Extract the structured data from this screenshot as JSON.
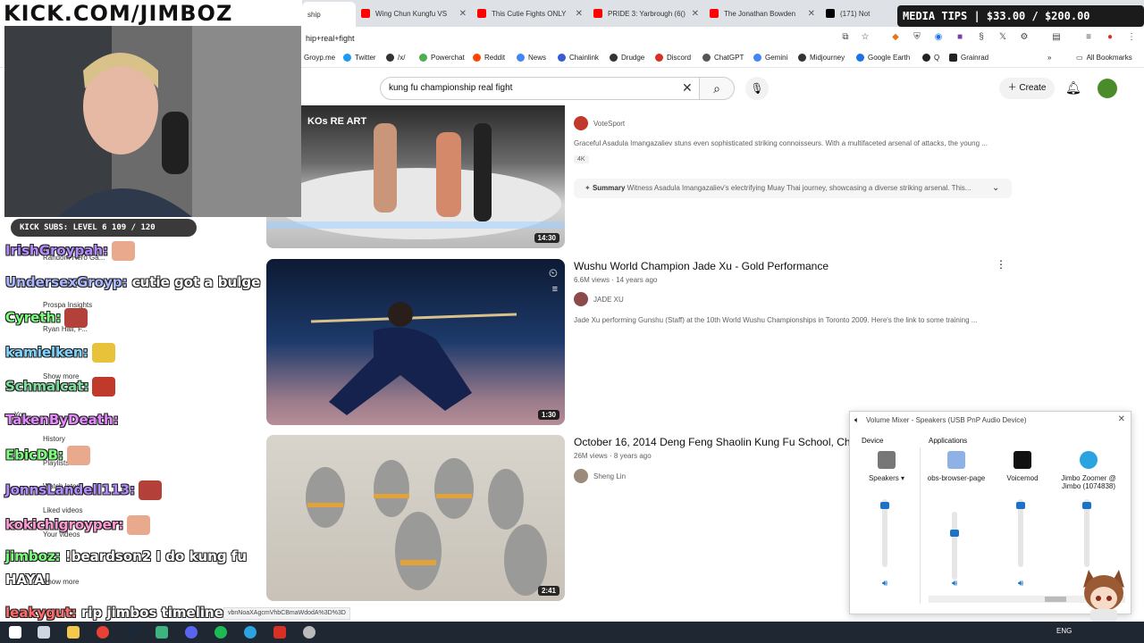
{
  "browser": {
    "tabs": [
      {
        "label": "ship",
        "active": true,
        "color": "#ff0000"
      },
      {
        "label": "Wing Chun Kungfu VS",
        "color": "#ff0000"
      },
      {
        "label": "This Cutie Fights ONLY",
        "color": "#ff0000"
      },
      {
        "label": "PRIDE 3: Yarbrough (6()",
        "color": "#ff0000"
      },
      {
        "label": "The Jonathan Bowden",
        "color": "#ff0000"
      },
      {
        "label": "(171) Not",
        "color": "#000000"
      }
    ],
    "url": "hip+real+fight",
    "bookmarks": [
      "Groyp.me",
      "Twitter",
      "/x/",
      "Powerchat",
      "Reddit",
      "News",
      "Chainlink",
      "Drudge",
      "Discord",
      "ChatGPT",
      "Gemini",
      "Midjourney",
      "Google Earth",
      "Q",
      "Grainrad"
    ],
    "all_bookmarks": "All Bookmarks",
    "status_url": "vbnNoaXAgcmVhbCBmaWdodA%3D%3D"
  },
  "youtube": {
    "search_query": "kung fu championship real fight",
    "create_label": "Create",
    "results": [
      {
        "channel": "VoteSport",
        "description": "Graceful Asadula Imangazaliev stuns even sophisticated striking connoisseurs. With a multifaceted arsenal of attacks, the young ...",
        "badge": "4K",
        "summary_label": "Summary",
        "summary_text": "Witness Asadula Imangazaliev's electrifying Muay Thai journey, showcasing a diverse striking arsenal. This...",
        "duration": "14:30",
        "thumb_text": "KOs RE ART"
      },
      {
        "title": "Wushu World Champion Jade Xu - Gold Performance",
        "meta": "6.6M views · 14 years ago",
        "channel": "JADE XU",
        "description": "Jade Xu performing Gunshu (Staff) at the 10th World Wushu Championships in Toronto 2009. Here's the link to some training ...",
        "duration": "1:30"
      },
      {
        "title": "October 16, 2014 Deng Feng Shaolin Kung Fu School, Chin",
        "meta": "26M views · 8 years ago",
        "channel": "Sheng Lin",
        "duration": "2:41"
      }
    ]
  },
  "overlay": {
    "kick_banner": "KICK.COM/JIMBOZ",
    "media_tips": "MEDIA TIPS | $33.00 / $200.00",
    "sub_bar": "KICK SUBS: LEVEL 6 109 / 120"
  },
  "sidebar": [
    "Random Hero Ga...",
    "Prospa Insights",
    "Ryan Hall, F...",
    "Show more",
    "You",
    "History",
    "Playlists",
    "Watch later",
    "Liked videos",
    "Your videos",
    "Show more"
  ],
  "chat": [
    {
      "user": "IrishGroypah:",
      "msg": "",
      "color": "#b48cff"
    },
    {
      "user": "UndersexGroyp:",
      "msg": "cutie got a bulge",
      "color": "#a9b8ff"
    },
    {
      "user": "Cyreth:",
      "msg": "",
      "color": "#7cff7c"
    },
    {
      "user": "kamielken:",
      "msg": "",
      "color": "#7fd6ff"
    },
    {
      "user": "Schmalcat:",
      "msg": "",
      "color": "#7fe0a0"
    },
    {
      "user": "TakenByDeath:",
      "msg": "",
      "color": "#e58aff"
    },
    {
      "user": "EbicDB:",
      "msg": "",
      "color": "#7cff7c"
    },
    {
      "user": "JonnsLandell113:",
      "msg": "",
      "color": "#b48cff"
    },
    {
      "user": "kokichigroyper:",
      "msg": "",
      "color": "#ff9ad5"
    },
    {
      "user": "jimboz:",
      "msg": "!beardson2 I do kung fu",
      "color": "#7cff7c"
    },
    {
      "user": "",
      "msg": "HAYA!",
      "color": "#ffffff"
    },
    {
      "user": "leakygut:",
      "msg": "rip jimbos timeline",
      "color": "#ff6a6a"
    }
  ],
  "mixer": {
    "title": "Volume Mixer - Speakers (USB PnP Audio Device)",
    "device_label": "Device",
    "apps_label": "Applications",
    "channels": [
      {
        "name": "Speakers",
        "level": 0.95
      },
      {
        "name": "obs-browser-page",
        "level": 0.7
      },
      {
        "name": "Voicemod",
        "level": 0.95
      },
      {
        "name": "Jimbo Zoomer @ Jimbo (1074838)",
        "level": 0.95
      }
    ]
  },
  "taskbar": {
    "lang": "ENG"
  }
}
